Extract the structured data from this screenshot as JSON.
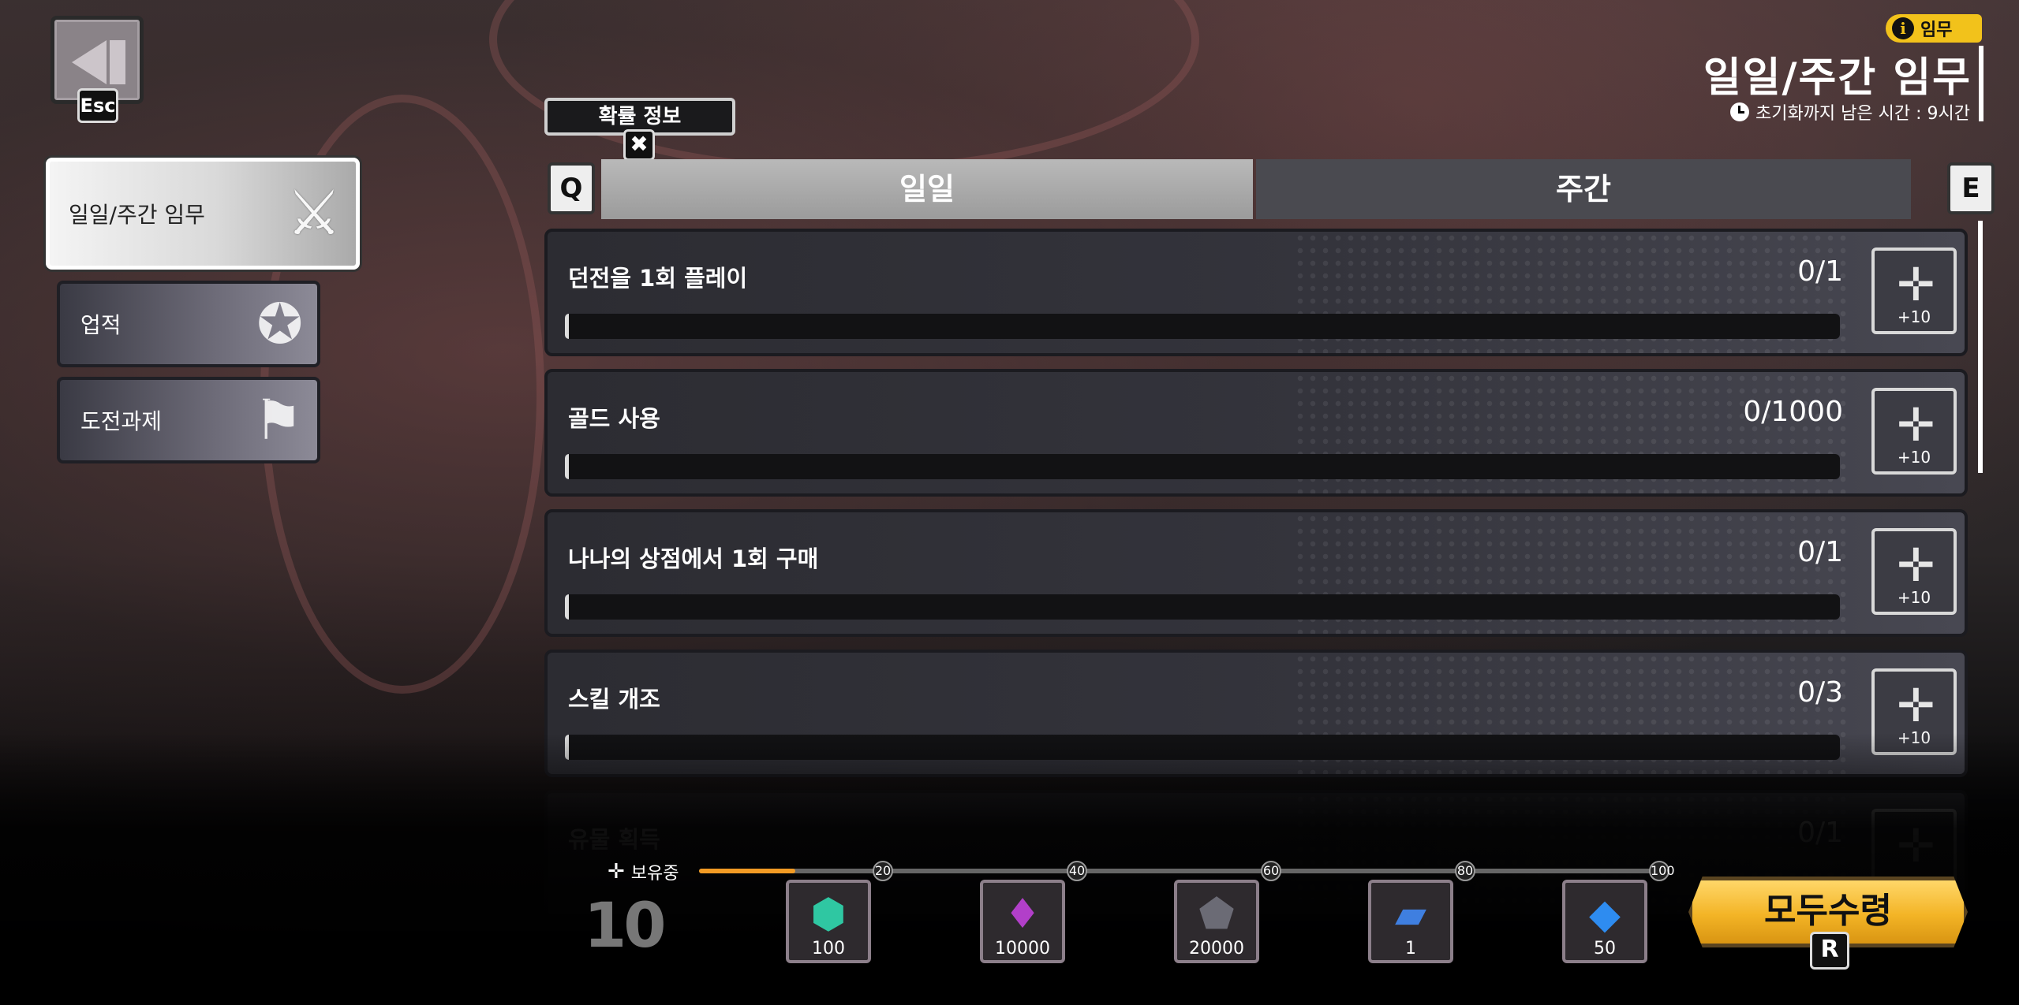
{
  "back": {
    "key": "Esc"
  },
  "sidebar": {
    "items": [
      {
        "label": "일일/주간 임무",
        "icon": "crossed-swords-icon",
        "active": true
      },
      {
        "label": "업적",
        "icon": "rank-badge-icon",
        "active": false
      },
      {
        "label": "도전과제",
        "icon": "crossed-flags-icon",
        "active": false
      }
    ]
  },
  "header": {
    "badge_label": "임무",
    "title": "일일/주간 임무",
    "reset_text": "초기화까지 남은 시간 : 9시간"
  },
  "probability_label": "확률 정보",
  "tabs": {
    "left_key": "Q",
    "right_key": "E",
    "items": [
      {
        "label": "일일",
        "active": true
      },
      {
        "label": "주간",
        "active": false
      }
    ]
  },
  "missions": [
    {
      "name": "던전을 1회 플레이",
      "count": "0/1",
      "progress": 0,
      "reward": "+10"
    },
    {
      "name": "골드 사용",
      "count": "0/1000",
      "progress": 0,
      "reward": "+10"
    },
    {
      "name": "나나의 상점에서 1회 구매",
      "count": "0/1",
      "progress": 0,
      "reward": "+10"
    },
    {
      "name": "스킬 개조",
      "count": "0/3",
      "progress": 0,
      "reward": "+10"
    },
    {
      "name": "유물 획득",
      "count": "0/1",
      "progress": 0,
      "reward": ""
    }
  ],
  "points": {
    "holding_label": "보유중",
    "value": "10",
    "progress_fraction": 0.1,
    "milestones": [
      "20",
      "40",
      "60",
      "80",
      "100"
    ]
  },
  "rewards": [
    {
      "amount": "100",
      "icon": "green-gem-icon",
      "color": "#2fc7a2"
    },
    {
      "amount": "10000",
      "icon": "purple-crystal-icon",
      "color": "#b23fc9"
    },
    {
      "amount": "20000",
      "icon": "dark-ore-icon",
      "color": "#6b6b75"
    },
    {
      "amount": "1",
      "icon": "blue-ticket-icon",
      "color": "#3f7fe0"
    },
    {
      "amount": "50",
      "icon": "blue-diamond-icon",
      "color": "#2e8cf0"
    }
  ],
  "claim_all": {
    "label": "모두수령",
    "key": "R"
  }
}
